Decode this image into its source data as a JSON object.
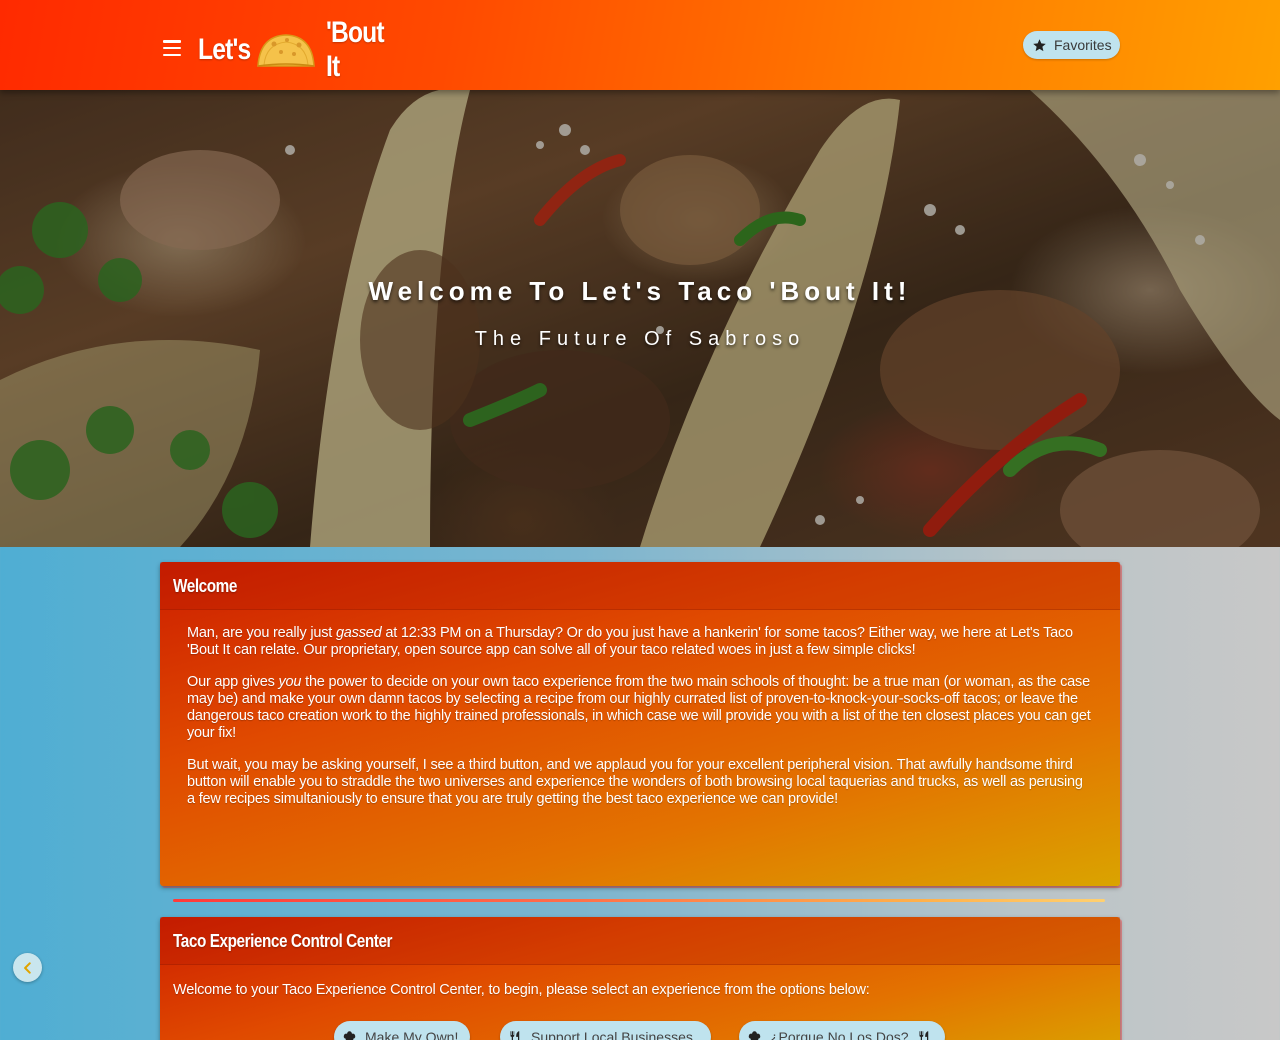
{
  "navbar": {
    "brand_left": "Let's",
    "brand_right": "'Bout It",
    "logo_icon": "taco-icon",
    "menu_icon": "hamburger-icon",
    "favorites_label": "Favorites",
    "favorites_icon": "star-icon"
  },
  "hero": {
    "title": "Welcome To Let's Taco 'Bout It!",
    "subtitle": "The Future Of Sabroso"
  },
  "welcome_card": {
    "title": "Welcome",
    "p1_before": "Man, are you really just ",
    "p1_em": "gassed",
    "p1_after": " at 12:33 PM on a Thursday? Or do you just have a hankerin' for some tacos? Either way, we here at Let's Taco 'Bout It can relate. Our proprietary, open source app can solve all of your taco related woes in just a few simple clicks!",
    "p2_before": "Our app gives ",
    "p2_em": "you",
    "p2_after": " the power to decide on your own taco experience from the two main schools of thought: be a true man (or woman, as the case may be) and make your own damn tacos by selecting a recipe from our highly currated list of proven-to-knock-your-socks-off tacos; or leave the dangerous taco creation work to the highly trained professionals, in which case we will provide you with a list of the ten closest places you can get your fix!",
    "p3": "But wait, you may be asking yourself, I see a third button, and we applaud you for your excellent peripheral vision. That awfully handsome third button will enable you to straddle the two universes and experience the wonders of both browsing local taquerias and trucks, as well as perusing a few recipes simultaniously to ensure that you are truly getting the best taco experience we can provide!"
  },
  "control_card": {
    "title": "Taco Experience Control Center",
    "intro": "Welcome to your Taco Experience Control Center, to begin, please select an experience from the options below:",
    "buttons": [
      {
        "label": "Make My Own!",
        "icon": "chef-hat-icon"
      },
      {
        "label": "Support Local Businesses",
        "icon": "utensils-icon"
      },
      {
        "label": "¿Porque No Los Dos?",
        "icon": "chef-hat-icon"
      }
    ]
  },
  "colors": {
    "nav_start": "#ff2a00",
    "nav_end": "#ffa000",
    "button_bg": "#bfe3ee",
    "card_start": "#cc1e00",
    "card_end": "#daa400"
  }
}
